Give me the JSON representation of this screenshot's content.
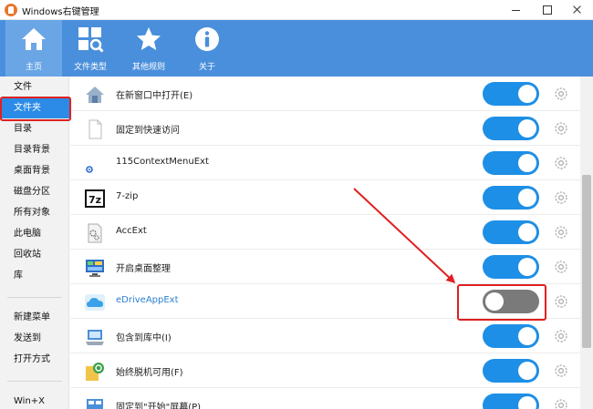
{
  "window": {
    "title": "Windows右键管理"
  },
  "toolbar": {
    "items": [
      {
        "label": "主页",
        "icon": "home-icon"
      },
      {
        "label": "文件类型",
        "icon": "file-type-icon"
      },
      {
        "label": "其他规则",
        "icon": "star-icon"
      },
      {
        "label": "关于",
        "icon": "info-icon"
      }
    ],
    "active": "主页"
  },
  "sidebar": {
    "items": [
      {
        "label": "文件"
      },
      {
        "label": "文件夹"
      },
      {
        "label": "目录"
      },
      {
        "label": "目录背景"
      },
      {
        "label": "桌面背景"
      },
      {
        "label": "磁盘分区"
      },
      {
        "label": "所有对象"
      },
      {
        "label": "此电脑"
      },
      {
        "label": "回收站"
      },
      {
        "label": "库"
      },
      {
        "label": "新建菜单"
      },
      {
        "label": "发送到"
      },
      {
        "label": "打开方式"
      },
      {
        "label": "Win+X"
      }
    ],
    "selected": "文件夹"
  },
  "rows": [
    {
      "label": "在新窗口中打开(E)",
      "enabled": true
    },
    {
      "label": "固定到快速访问",
      "enabled": true
    },
    {
      "label": "115ContextMenuExt",
      "enabled": true
    },
    {
      "label": "7-zip",
      "enabled": true,
      "icon_text": "7z"
    },
    {
      "label": "AccExt",
      "enabled": true
    },
    {
      "label": "开启桌面整理",
      "enabled": true
    },
    {
      "label": "eDriveAppExt",
      "enabled": false
    },
    {
      "label": "包含到库中(I)",
      "enabled": true
    },
    {
      "label": "始终脱机可用(F)",
      "enabled": true
    },
    {
      "label": "固定到\"开始\"屏幕(P)",
      "enabled": true
    }
  ],
  "colors": {
    "toolbar": "#4a8fdb",
    "toggle_on": "#1e8fe6",
    "toggle_off": "#7a7a7a",
    "highlight": "#e02020"
  }
}
